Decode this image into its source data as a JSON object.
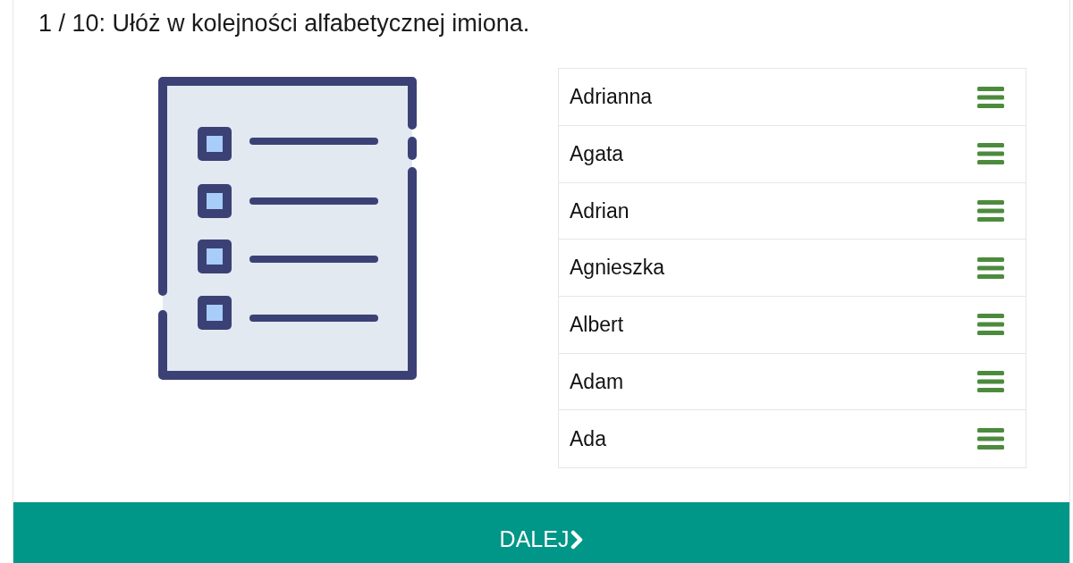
{
  "question": {
    "title": "1 / 10: Ułóż w kolejności alfabetycznej imiona."
  },
  "items": [
    {
      "label": "Adrianna"
    },
    {
      "label": "Agata"
    },
    {
      "label": "Adrian"
    },
    {
      "label": "Agnieszka"
    },
    {
      "label": "Albert"
    },
    {
      "label": "Adam"
    },
    {
      "label": "Ada"
    }
  ],
  "next_button": {
    "label": "DALEJ"
  }
}
